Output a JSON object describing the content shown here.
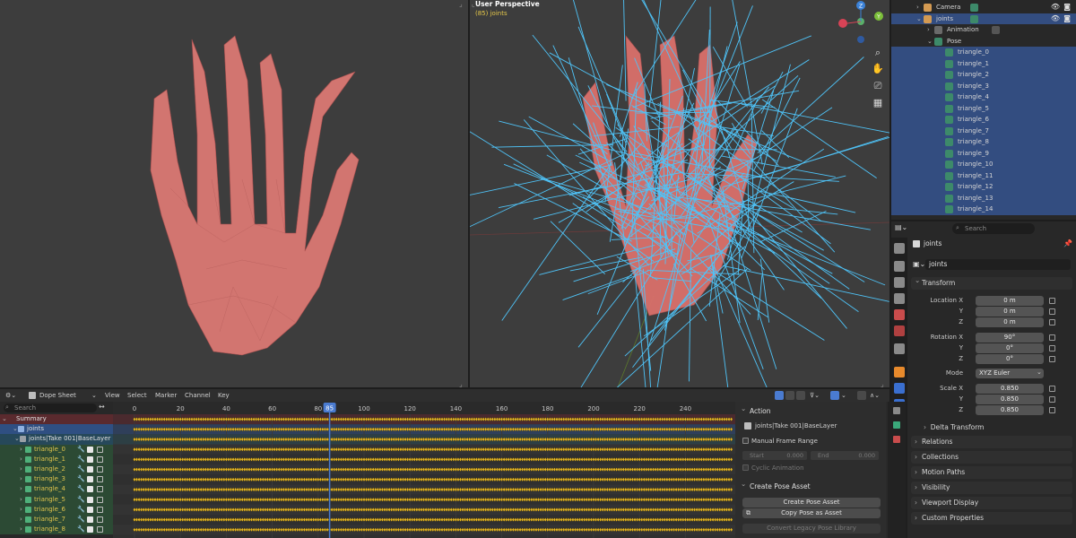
{
  "viewport_right": {
    "title": "User Perspective",
    "subtitle": "(85) joints"
  },
  "outliner": {
    "camera": "Camera",
    "joints": "joints",
    "animation": "Animation",
    "pose": "Pose",
    "bones": [
      "triangle_0",
      "triangle_1",
      "triangle_2",
      "triangle_3",
      "triangle_4",
      "triangle_5",
      "triangle_6",
      "triangle_7",
      "triangle_8",
      "triangle_9",
      "triangle_10",
      "triangle_11",
      "triangle_12",
      "triangle_13",
      "triangle_14"
    ]
  },
  "properties": {
    "search_placeholder": "Search",
    "object_name": "joints",
    "datablock_name": "joints",
    "transform_label": "Transform",
    "location_label": "Location X",
    "y_label": "Y",
    "z_label": "Z",
    "location": [
      "0 m",
      "0 m",
      "0 m"
    ],
    "rotation_label": "Rotation X",
    "rotation": [
      "90°",
      "0°",
      "0°"
    ],
    "mode_label": "Mode",
    "mode_value": "XYZ Euler",
    "scale_label": "Scale X",
    "scale": [
      "0.850",
      "0.850",
      "0.850"
    ],
    "delta_transform": "Delta Transform",
    "sections": [
      "Relations",
      "Collections",
      "Motion Paths",
      "Visibility",
      "Viewport Display",
      "Custom Properties"
    ]
  },
  "dopesheet": {
    "mode": "Dope Sheet",
    "menus": [
      "View",
      "Select",
      "Marker",
      "Channel",
      "Key"
    ],
    "search_placeholder": "Search",
    "frame_current": "85",
    "frame_labels": [
      "0",
      "20",
      "40",
      "60",
      "80",
      "100",
      "120",
      "140",
      "160",
      "180",
      "200",
      "220",
      "240"
    ],
    "channels": {
      "summary": "Summary",
      "object": "joints",
      "action": "joints|Take 001|BaseLayer",
      "bones": [
        "triangle_0",
        "triangle_1",
        "triangle_2",
        "triangle_3",
        "triangle_4",
        "triangle_5",
        "triangle_6",
        "triangle_7",
        "triangle_8"
      ]
    }
  },
  "action_panel": {
    "action_header": "Action",
    "action_name": "joints|Take 001|BaseLayer",
    "manual_frame_range": "Manual Frame Range",
    "start_label": "Start",
    "start_value": "0.000",
    "end_label": "End",
    "end_value": "0.000",
    "cyclic": "Cyclic Animation",
    "pose_asset_header": "Create Pose Asset",
    "create_pose_asset": "Create Pose Asset",
    "copy_pose_asset": "Copy Pose as Asset",
    "convert_legacy": "Convert Legacy Pose Library"
  },
  "colors": {
    "selection": "#334d80",
    "keyframe": "#e8b820",
    "bones": "#4fc3f7",
    "mesh": "#d9706b",
    "playhead": "#4a7bd0"
  }
}
